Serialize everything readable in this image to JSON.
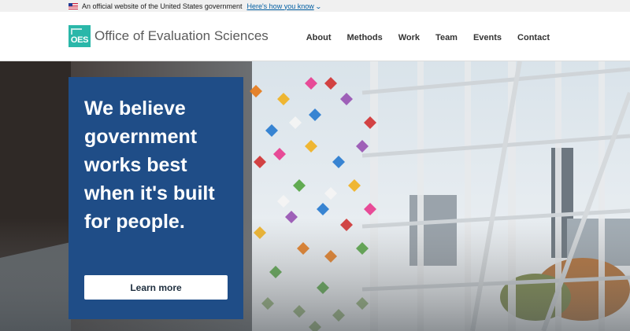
{
  "gov_banner": {
    "text": "An official website of the United States government",
    "link": "Here's how you know"
  },
  "header": {
    "logo_text": "OES",
    "brand_name": "Office of Evaluation Sciences",
    "nav": [
      "About",
      "Methods",
      "Work",
      "Team",
      "Events",
      "Contact"
    ]
  },
  "hero": {
    "headline": "We believe government works best when it's built for people.",
    "button_label": "Learn more"
  },
  "colors": {
    "brand_teal": "#2ab7a9",
    "hero_blue": "#1f4d87",
    "link_blue": "#005ea2"
  }
}
